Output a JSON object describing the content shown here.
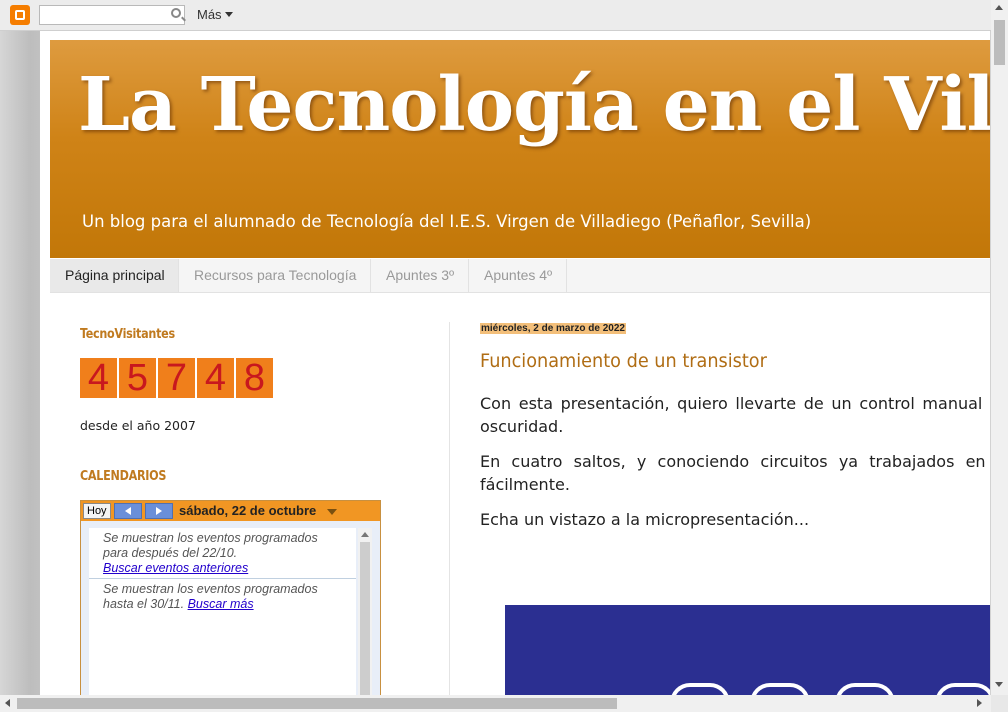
{
  "navbar": {
    "logo_icon": "blogger-logo-icon",
    "search_placeholder": "",
    "more_label": "Más"
  },
  "header": {
    "title": "La Tecnología en el Villa",
    "description": "Un blog para el alumnado de Tecnología del I.E.S. Virgen de Villadiego (Peñaflor, Sevilla)"
  },
  "tabs": [
    {
      "label": "Página principal",
      "active": true
    },
    {
      "label": "Recursos para Tecnología",
      "active": false
    },
    {
      "label": "Apuntes 3º",
      "active": false
    },
    {
      "label": "Apuntes 4º",
      "active": false
    }
  ],
  "sidebar": {
    "visitors_title": "TecnoVisitantes",
    "counter_digits": [
      "4",
      "5",
      "7",
      "4",
      "8"
    ],
    "since_text": "desde el año 2007",
    "calendars_title": "CALENDARIOS",
    "calendar": {
      "today_button": "Hoy",
      "date_label": "sábado, 22 de octubre",
      "msg1_text": "Se muestran los eventos programados para después del 22/10.",
      "msg1_link": "Buscar eventos anteriores",
      "msg2_text": "Se muestran los eventos programados hasta el 30/11.",
      "msg2_link": "Buscar más"
    }
  },
  "post": {
    "date": "miércoles, 2 de marzo de 2022",
    "title": "Funcionamiento de un transistor",
    "paragraph1": " Con esta presentación, quiero llevarte de un control manual de oscuridad.",
    "paragraph2": "En cuatro saltos, y conociendo circuitos ya trabajados en cl fácilmente.",
    "paragraph3": "Echa un vistazo a la micropresentación..."
  },
  "colors": {
    "header_orange": "#cf8317",
    "sidebar_title": "#c07a1f",
    "counter_bg": "#f07f1b",
    "counter_fg": "#c8181e",
    "slide_bg": "#2b2f91"
  }
}
